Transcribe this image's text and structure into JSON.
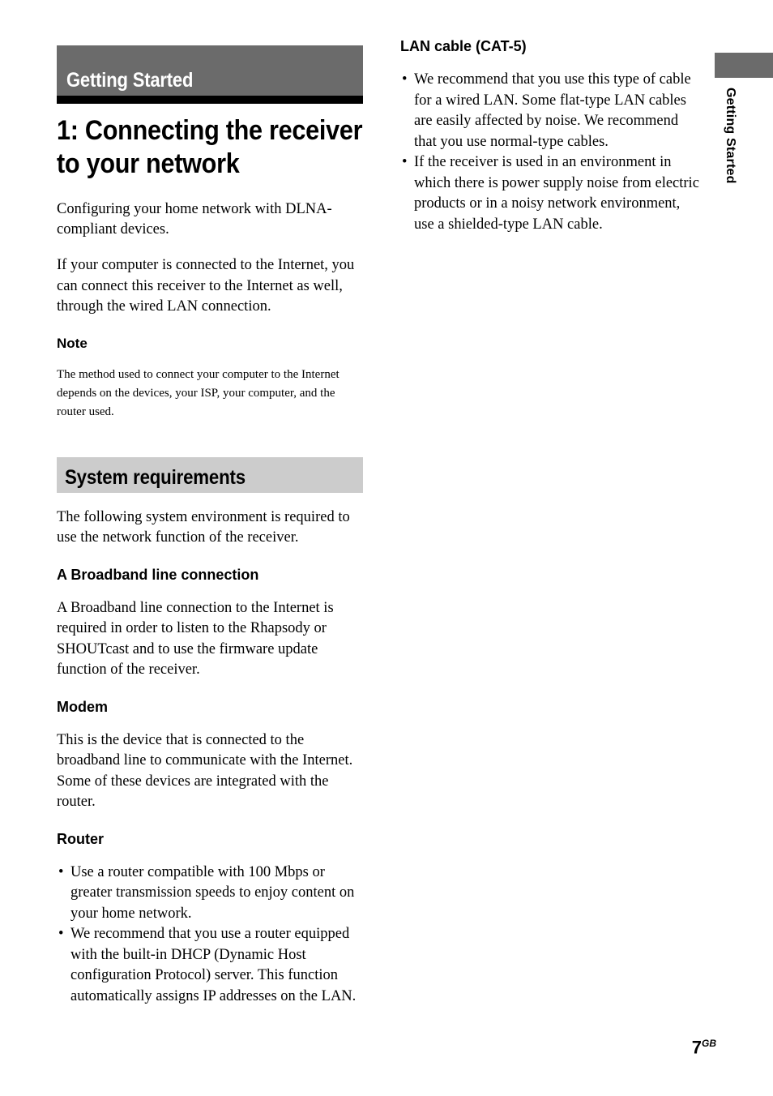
{
  "document": {
    "section_label": "Getting Started",
    "chapter_title": "1: Connecting the receiver to your network",
    "page_number": "7",
    "page_number_suffix": "GB"
  },
  "side_tab": {
    "label": "Getting Started"
  },
  "left_column": {
    "intro_paragraph_1": "Configuring your home network with DLNA-compliant devices.",
    "intro_paragraph_2": "If your computer is connected to the Internet, you can connect this receiver to the Internet as well, through the wired LAN connection.",
    "note_heading": "Note",
    "note_body": "The method used to connect your computer to the Internet depends on the devices, your ISP, your computer, and the router used.",
    "sub_band_label": "System requirements",
    "requirements_intro": "The following system environment is required to use the network function of the receiver.",
    "broadband": {
      "heading": "A Broadband line connection",
      "body": "A Broadband line connection to the Internet is required in order to listen to the Rhapsody or SHOUTcast and to use the firmware update function of the receiver."
    },
    "modem": {
      "heading": "Modem",
      "body": "This is the device that is connected to the broadband line to communicate with the Internet. Some of these devices are integrated with the router."
    },
    "router": {
      "heading": "Router",
      "bullet_marker": "•",
      "bullets": [
        "Use a router compatible with 100 Mbps or greater transmission speeds to enjoy content on your home network.",
        "We recommend that you use a router equipped with the built-in DHCP (Dynamic Host configuration Protocol) server. This function automatically assigns IP addresses on the LAN."
      ]
    }
  },
  "right_column": {
    "lan_cable": {
      "heading": "LAN cable (CAT-5)",
      "bullet_marker": "•",
      "bullets": [
        "We recommend that you use this type of cable for a wired LAN. Some flat-type LAN cables are easily affected by noise. We recommend that you use normal-type cables.",
        "If the receiver is used in an environment in which there is power supply noise from electric products or in a noisy network environment, use a shielded-type LAN cable."
      ]
    }
  },
  "colors": {
    "section_band": "#6b6b6b",
    "section_rule": "#000000",
    "sub_band": "#cccccc",
    "text": "#000000",
    "page_background": "#ffffff"
  }
}
